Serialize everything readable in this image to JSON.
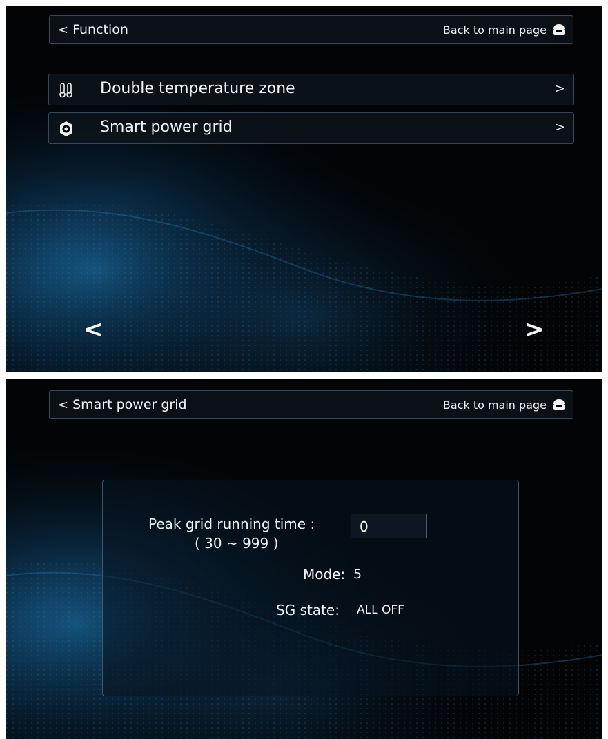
{
  "screen1": {
    "header": {
      "back_label": "Function",
      "back_chevron": "<",
      "home_label": "Back to main page",
      "home_icon": "home-icon"
    },
    "menu": [
      {
        "label": "Double temperature zone",
        "icon": "thermometer-icon",
        "arrow": ">"
      },
      {
        "label": "Smart power grid",
        "icon": "power-grid-icon",
        "arrow": ">"
      }
    ],
    "pager": {
      "prev": "<",
      "next": ">"
    }
  },
  "screen2": {
    "header": {
      "back_label": "Smart power grid",
      "back_chevron": "<",
      "home_label": "Back to main page",
      "home_icon": "home-icon"
    },
    "panel": {
      "peak_label": "Peak grid running time :",
      "peak_value": "0",
      "peak_range": "( 30 ~ 999 )",
      "mode_label": "Mode:",
      "mode_value": "5",
      "sg_label": "SG state:",
      "sg_value": "ALL OFF"
    }
  },
  "colors": {
    "background": "#020406",
    "accent_blue": "#1d6fa8",
    "border": "#6e8caa",
    "text": "#eef3f8"
  }
}
